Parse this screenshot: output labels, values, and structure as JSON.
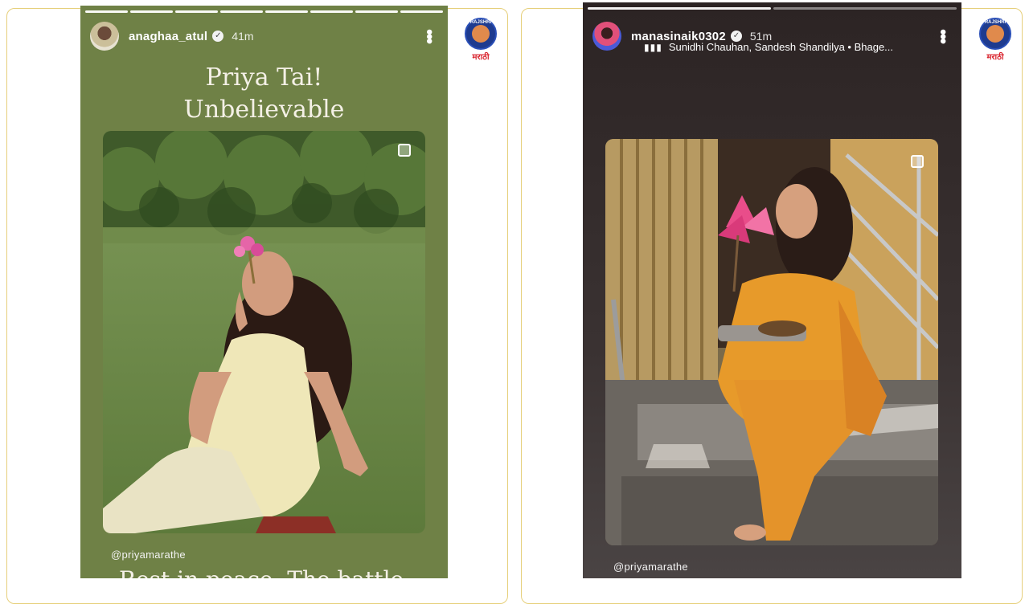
{
  "left_story": {
    "username": "anaghaa_atul",
    "time": "41m",
    "progress_segments": 8,
    "progress_done": 8,
    "title_line1": "Priya Tai!",
    "title_line2": "Unbelievable",
    "mention": "@priyamarathe",
    "bottom_text": "Rest in peace. The battle"
  },
  "right_story": {
    "username": "manasinaik0302",
    "time": "51m",
    "progress_segments": 2,
    "progress_done": 1,
    "music_text": "Sunidhi Chauhan, Sandesh Shandilya • Bhage...",
    "mention": "@priyamarathe"
  },
  "brand": {
    "label": "मराठी",
    "ring_text": "RAJSHRI",
    "color": "#d9232d"
  }
}
